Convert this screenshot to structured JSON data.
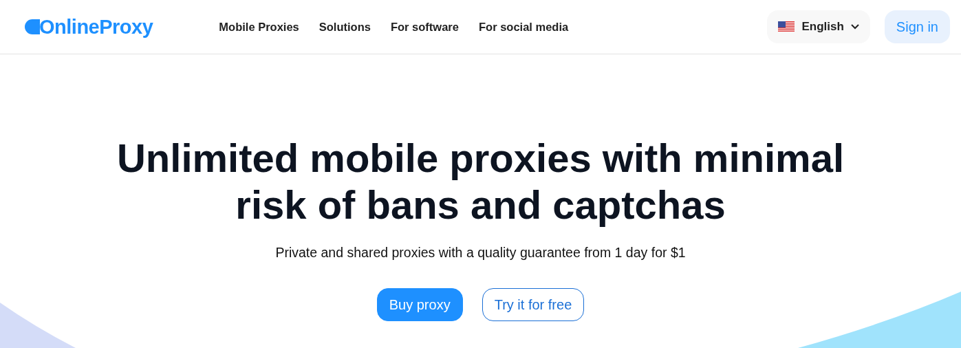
{
  "header": {
    "logo": "OnlineProxy",
    "nav": [
      "Mobile Proxies",
      "Solutions",
      "For software",
      "For social media"
    ],
    "language": "English",
    "sign_in": "Sign in"
  },
  "hero": {
    "title": "Unlimited mobile proxies with minimal risk of bans and captchas",
    "subtitle": "Private and shared proxies with a quality guarantee from 1 day for $1",
    "buttons": [
      {
        "label": "Buy proxy",
        "kind": "primary"
      },
      {
        "label": "Try it for free",
        "kind": "outline"
      }
    ]
  }
}
